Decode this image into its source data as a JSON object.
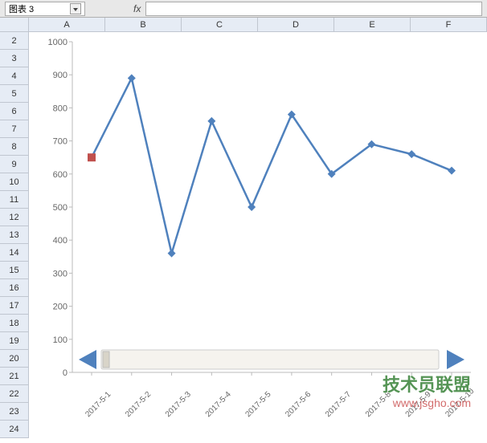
{
  "formula_bar": {
    "name_box": "图表 3",
    "fx_label": "fx",
    "fx_value": ""
  },
  "columns": [
    "A",
    "B",
    "C",
    "D",
    "E",
    "F"
  ],
  "rows": [
    "2",
    "3",
    "4",
    "5",
    "6",
    "7",
    "8",
    "9",
    "10",
    "11",
    "12",
    "13",
    "14",
    "15",
    "16",
    "17",
    "18",
    "19",
    "20",
    "21",
    "22",
    "23",
    "24"
  ],
  "chart_data": {
    "type": "line",
    "categories": [
      "2017-5-1",
      "2017-5-2",
      "2017-5-3",
      "2017-5-4",
      "2017-5-5",
      "2017-5-6",
      "2017-5-7",
      "2017-5-8",
      "2017-5-9",
      "2017-5-10"
    ],
    "values": [
      650,
      890,
      360,
      760,
      500,
      780,
      600,
      690,
      660,
      610
    ],
    "highlight_index": 0,
    "title": "",
    "xlabel": "",
    "ylabel": "",
    "ylim": [
      0,
      1000
    ],
    "yticks": [
      0,
      100,
      200,
      300,
      400,
      500,
      600,
      700,
      800,
      900,
      1000
    ]
  },
  "watermark": {
    "main": "技术员联盟",
    "sub": "www.jsgho.com"
  }
}
